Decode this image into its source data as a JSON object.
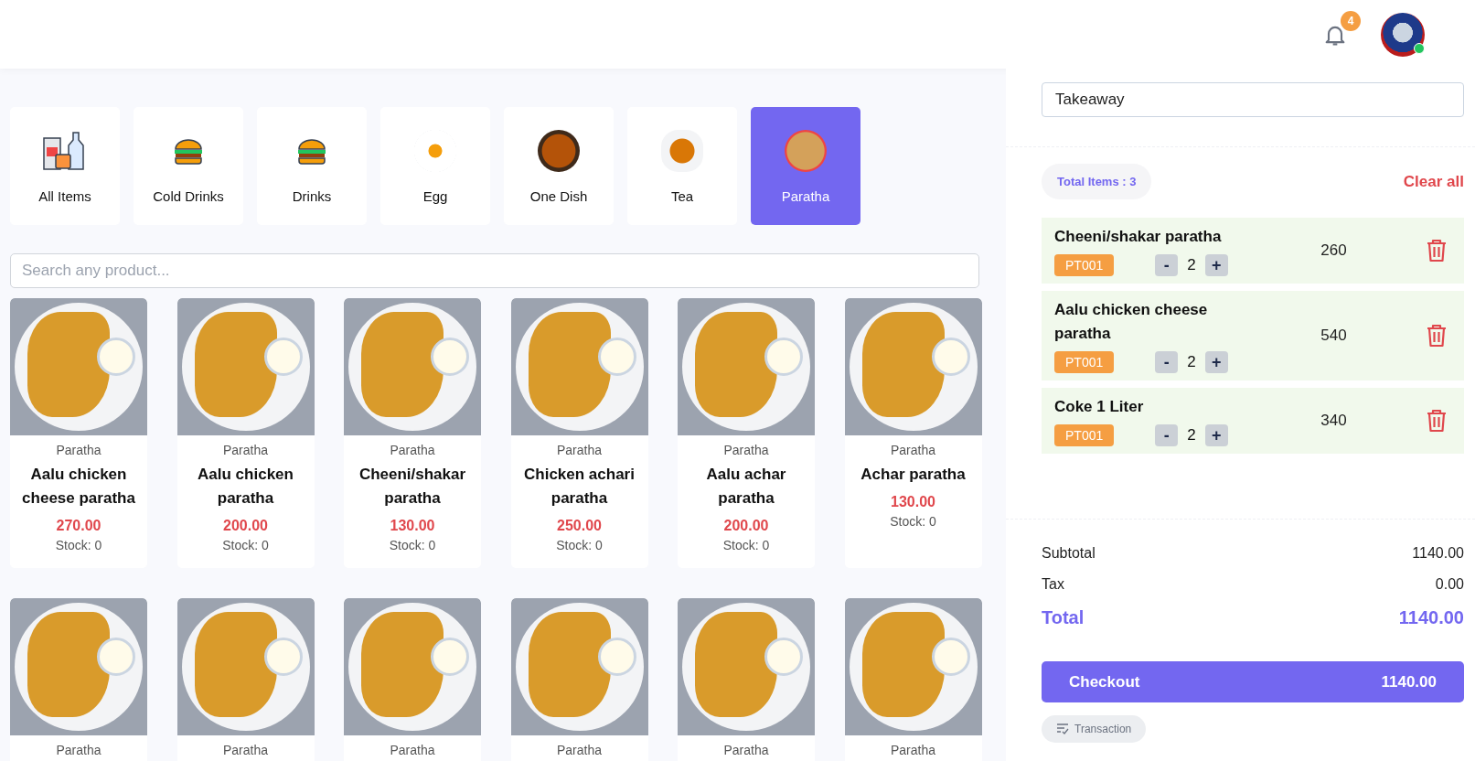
{
  "header": {
    "notification_count": "4",
    "user_online": true
  },
  "categories": [
    {
      "label": "All Items",
      "selected": false
    },
    {
      "label": "Cold Drinks",
      "selected": false
    },
    {
      "label": "Drinks",
      "selected": false
    },
    {
      "label": "Egg",
      "selected": false
    },
    {
      "label": "One Dish",
      "selected": false
    },
    {
      "label": "Tea",
      "selected": false
    },
    {
      "label": "Paratha",
      "selected": true
    }
  ],
  "search": {
    "placeholder": "Search any product..."
  },
  "products": [
    {
      "category": "Paratha",
      "name": "Aalu chicken cheese paratha",
      "price": "270.00",
      "stock": "Stock: 0"
    },
    {
      "category": "Paratha",
      "name": "Aalu chicken paratha",
      "price": "200.00",
      "stock": "Stock: 0"
    },
    {
      "category": "Paratha",
      "name": "Cheeni/shakar paratha",
      "price": "130.00",
      "stock": "Stock: 0"
    },
    {
      "category": "Paratha",
      "name": "Chicken achari paratha",
      "price": "250.00",
      "stock": "Stock: 0"
    },
    {
      "category": "Paratha",
      "name": "Aalu achar paratha",
      "price": "200.00",
      "stock": "Stock: 0"
    },
    {
      "category": "Paratha",
      "name": "Achar paratha",
      "price": "130.00",
      "stock": "Stock: 0"
    },
    {
      "category": "Paratha"
    },
    {
      "category": "Paratha"
    },
    {
      "category": "Paratha"
    },
    {
      "category": "Paratha"
    },
    {
      "category": "Paratha"
    },
    {
      "category": "Paratha"
    }
  ],
  "order": {
    "type": "Takeaway",
    "total_items": "Total Items : 3",
    "clear": "Clear all"
  },
  "cart": [
    {
      "name": "Cheeni/shakar paratha",
      "code": "PT001",
      "qty": "2",
      "minus": "-",
      "plus": "+",
      "amount": "260"
    },
    {
      "name": "Aalu chicken cheese paratha",
      "code": "PT001",
      "qty": "2",
      "minus": "-",
      "plus": "+",
      "amount": "540"
    },
    {
      "name": "Coke 1 Liter",
      "code": "PT001",
      "qty": "2",
      "minus": "-",
      "plus": "+",
      "amount": "340"
    }
  ],
  "summary": [
    {
      "label": "Subtotal",
      "value": "1140.00",
      "kind": "normal"
    },
    {
      "label": "Tax",
      "value": "0.00",
      "kind": "normal"
    },
    {
      "label": "Total",
      "value": "1140.00",
      "kind": "total"
    }
  ],
  "checkout": {
    "label": "Checkout",
    "amount": "1140.00"
  },
  "transaction": "Transaction"
}
